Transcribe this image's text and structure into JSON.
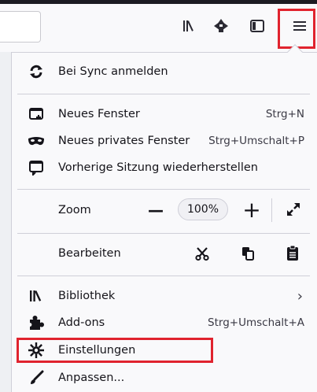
{
  "toolbar": {
    "library_icon": "library-icon",
    "extension_icon": "puzzle-icon",
    "sidebar_icon": "sidebar-icon",
    "menu_icon": "hamburger-menu-icon"
  },
  "colors": {
    "highlight": "#e0232e",
    "text": "#15141a",
    "menu_bg": "#f9f9fb"
  },
  "menu": {
    "sync": {
      "label": "Bei Sync anmelden",
      "icon": "sync-icon"
    },
    "new_window": {
      "label": "Neues Fenster",
      "shortcut": "Strg+N",
      "icon": "new-window-icon"
    },
    "private_window": {
      "label": "Neues privates Fenster",
      "shortcut": "Strg+Umschalt+P",
      "icon": "private-mask-icon"
    },
    "restore_session": {
      "label": "Vorherige Sitzung wiederherstellen",
      "icon": "restore-session-icon"
    },
    "zoom": {
      "label": "Zoom",
      "minus": "—",
      "value": "100%",
      "plus": "+",
      "fullscreen_icon": "fullscreen-icon"
    },
    "edit": {
      "label": "Bearbeiten",
      "cut_icon": "scissors-icon",
      "copy_icon": "copy-icon",
      "paste_icon": "clipboard-icon"
    },
    "library": {
      "label": "Bibliothek",
      "chevron": "›",
      "icon": "library-icon"
    },
    "addons": {
      "label": "Add-ons",
      "shortcut": "Strg+Umschalt+A",
      "icon": "puzzle-piece-icon"
    },
    "settings": {
      "label": "Einstellungen",
      "icon": "gear-icon"
    },
    "customize": {
      "label": "Anpassen...",
      "icon": "brush-icon"
    }
  }
}
